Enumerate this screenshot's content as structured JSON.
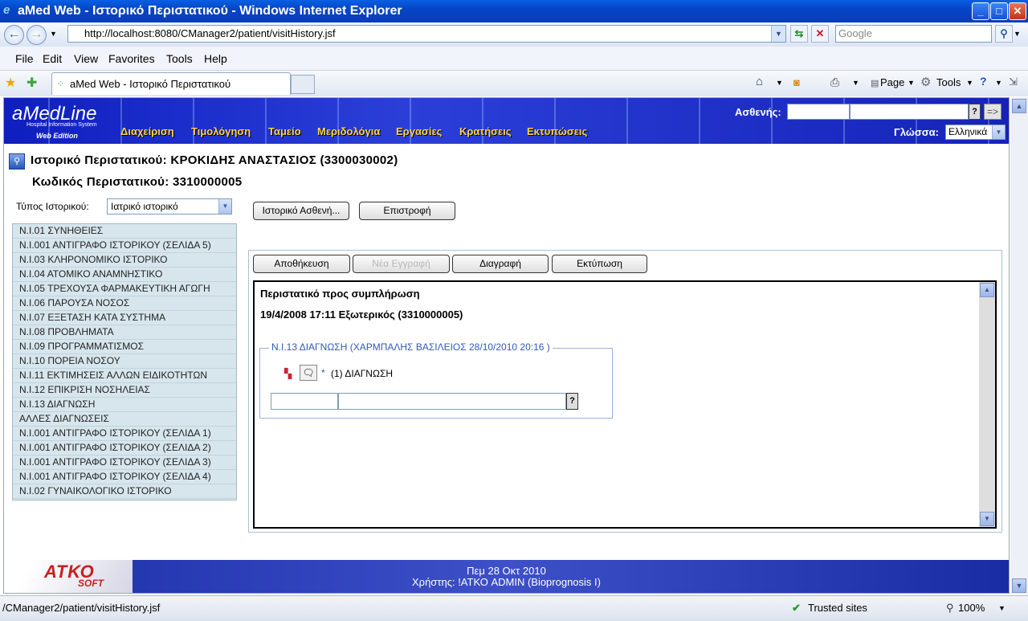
{
  "window": {
    "title": "aMed Web - Ιστορικό Περιστατικού - Windows Internet Explorer",
    "controls": [
      "_",
      "□",
      "✕"
    ]
  },
  "browser": {
    "url": "http://localhost:8080/CManager2/patient/visitHistory.jsf",
    "search_placeholder": "Google",
    "menu": [
      "File",
      "Edit",
      "View",
      "Favorites",
      "Tools",
      "Help"
    ],
    "tab_title": "aMed Web - Ιστορικό Περιστατικού",
    "toolbar": {
      "page": "Page",
      "tools": "Tools"
    },
    "status_url": "/CManager2/patient/visitHistory.jsf",
    "zone": "Trusted sites",
    "zoom": "100%"
  },
  "header": {
    "logo": "aMedLine",
    "logo_sub": "Hospital Information System",
    "logo_edition": "Web Edition",
    "nav": [
      "Διαχείριση",
      "Τιμολόγηση",
      "Ταμείο",
      "Μεριδολόγια",
      "Εργασίες",
      "Κρατήσεις",
      "Εκτυπώσεις"
    ],
    "patient_label": "Ασθενής:",
    "patient_query_button": "?",
    "patient_go_button": "=>",
    "language_label": "Γλώσσα:",
    "language_value": "Ελληνικά"
  },
  "page": {
    "title": "Ιστορικό Περιστατικού: ΚΡΟΚΙΔΗΣ ΑΝΑΣΤΑΣΙΟΣ (3300030002)",
    "subtitle": "Κωδικός Περιστατικού: 3310000005",
    "history_type_label": "Τύπος Ιστορικού:",
    "history_type_value": "Ιατρικό ιστορικό",
    "history_items": [
      "Ν.Ι.01 ΣΥΝΗΘΕΙΕΣ",
      "Ν.Ι.001 ΑΝΤΙΓΡΑΦΟ ΙΣΤΟΡΙΚΟΥ (ΣΕΛΙΔΑ 5)",
      "Ν.Ι.03 ΚΛΗΡΟΝΟΜΙΚΟ ΙΣΤΟΡΙΚΟ",
      "Ν.Ι.04 ΑΤΟΜΙΚΟ ΑΝΑΜΝΗΣΤΙΚΟ",
      "Ν.Ι.05 ΤΡΕΧΟΥΣΑ ΦΑΡΜΑΚΕΥΤΙΚΗ ΑΓΩΓΗ",
      "Ν.Ι.06 ΠΑΡΟΥΣΑ ΝΟΣΟΣ",
      "Ν.Ι.07 ΕΞΕΤΑΣΗ ΚΑΤΑ ΣΥΣΤΗΜΑ",
      "Ν.Ι.08 ΠΡΟΒΛΗΜΑΤΑ",
      "Ν.Ι.09 ΠΡΟΓΡΑΜΜΑΤΙΣΜΟΣ",
      "Ν.Ι.10 ΠΟΡΕΙΑ ΝΟΣΟΥ",
      "Ν.Ι.11 ΕΚΤΙΜΗΣΕΙΣ ΑΛΛΩΝ ΕΙΔΙΚΟΤΗΤΩΝ",
      "Ν.Ι.12 ΕΠΙΚΡΙΣΗ ΝΟΣΗΛΕΙΑΣ",
      "Ν.Ι.13 ΔΙΑΓΝΩΣΗ",
      "ΑΛΛΕΣ ΔΙΑΓΝΩΣΕΙΣ",
      "Ν.Ι.001 ΑΝΤΙΓΡΑΦΟ ΙΣΤΟΡΙΚΟΥ (ΣΕΛΙΔΑ 1)",
      "Ν.Ι.001 ΑΝΤΙΓΡΑΦΟ ΙΣΤΟΡΙΚΟΥ (ΣΕΛΙΔΑ 2)",
      "Ν.Ι.001 ΑΝΤΙΓΡΑΦΟ ΙΣΤΟΡΙΚΟΥ (ΣΕΛΙΔΑ 3)",
      "Ν.Ι.001 ΑΝΤΙΓΡΑΦΟ ΙΣΤΟΡΙΚΟΥ (ΣΕΛΙΔΑ 4)",
      "Ν.Ι.02 ΓΥΝΑΙΚΟΛΟΓΙΚΟ ΙΣΤΟΡΙΚΟ"
    ],
    "patient_history_button": "Ιστορικό Ασθενή...",
    "back_button": "Επιστροφή",
    "actions": {
      "save": "Αποθήκευση",
      "new": "Νέα Εγγραφή",
      "delete": "Διαγραφή",
      "print": "Εκτύπωση"
    },
    "editor": {
      "line1": "Περιστατικό προς συμπλήρωση",
      "line2": "19/4/2008 17:11 Εξωτερικός (3310000005)",
      "section_legend": "Ν.Ι.13 ΔΙΑΓΝΩΣΗ (ΧΑΡΜΠΑΛΗΣ ΒΑΣΙΛΕΙΟΣ 28/10/2010 20:16 )",
      "required_mark": "*",
      "diagnosis_label": "(1) ΔΙΑΓΝΩΣΗ",
      "lookup_button": "?"
    }
  },
  "footer": {
    "logo_line1": "ΑΤΚΟ",
    "logo_line2": "SOFT",
    "date": "Πεμ 28 Οκτ 2010",
    "user": "Χρήστης: !ΑΤΚΟ ADMIN (Bioprognosis I)"
  },
  "colors": {
    "banner": "#1f30c4",
    "nav_text": "#ffd24a",
    "list_bg": "#d7e6ed",
    "legend": "#3359b8"
  }
}
